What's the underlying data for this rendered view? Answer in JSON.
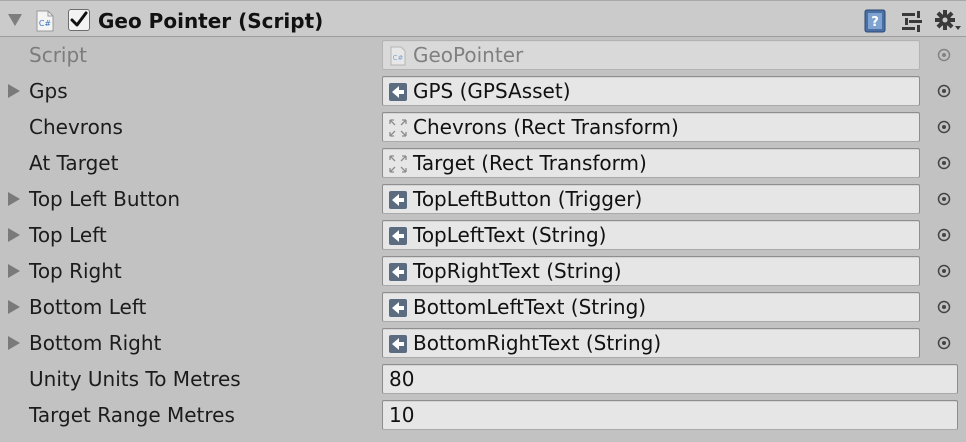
{
  "component": {
    "title": "Geo Pointer (Script)",
    "enabled": true
  },
  "colors": {
    "background": "#c2c2c2",
    "field": "#e6e6e6",
    "help": "#4a6fa5"
  },
  "icons": {
    "script": "csharp-script-icon",
    "scriptable": "scriptable-object-icon",
    "rect_transform": "rect-transform-icon",
    "help": "help-book-icon",
    "preset": "preset-sliders-icon",
    "settings": "gear-icon",
    "picker": "object-picker-icon"
  },
  "properties": [
    {
      "label": "Script",
      "value": "GeoPointer",
      "kind": "script",
      "disabled": true
    },
    {
      "label": "Gps",
      "value": "GPS (GPSAsset)",
      "kind": "asset",
      "foldout": true
    },
    {
      "label": "Chevrons",
      "value": "Chevrons (Rect Transform)",
      "kind": "rect"
    },
    {
      "label": "At Target",
      "value": "Target (Rect Transform)",
      "kind": "rect"
    },
    {
      "label": "Top Left Button",
      "value": "TopLeftButton (Trigger)",
      "kind": "asset",
      "foldout": true
    },
    {
      "label": "Top Left",
      "value": "TopLeftText (String)",
      "kind": "asset",
      "foldout": true
    },
    {
      "label": "Top Right",
      "value": "TopRightText (String)",
      "kind": "asset",
      "foldout": true
    },
    {
      "label": "Bottom Left",
      "value": "BottomLeftText (String)",
      "kind": "asset",
      "foldout": true
    },
    {
      "label": "Bottom Right",
      "value": "BottomRightText (String)",
      "kind": "asset",
      "foldout": true
    },
    {
      "label": "Unity Units To Metres",
      "value": "80",
      "kind": "number"
    },
    {
      "label": "Target Range Metres",
      "value": "10",
      "kind": "number"
    }
  ]
}
